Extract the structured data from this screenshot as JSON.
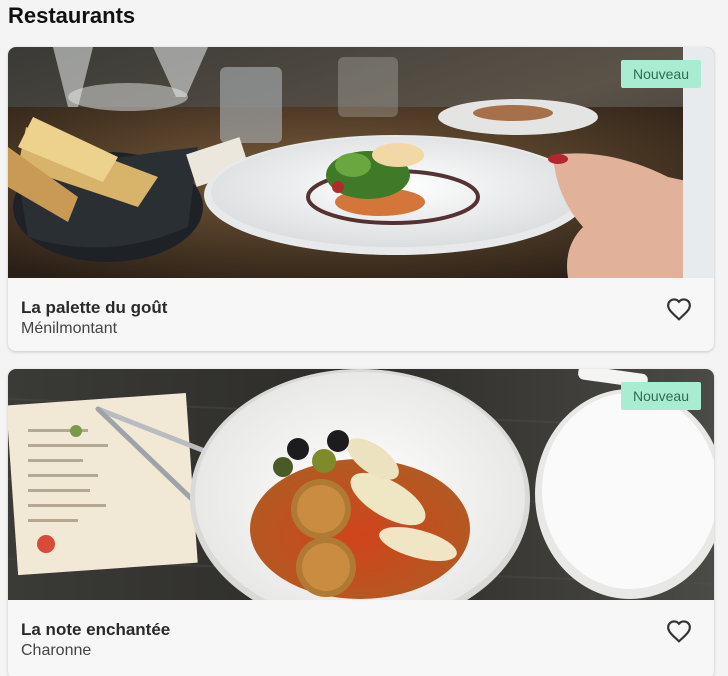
{
  "page": {
    "title": "Restaurants"
  },
  "restaurants": [
    {
      "name": "La palette du goût",
      "location": "Ménilmontant",
      "badge": "Nouveau",
      "favorite_icon": "heart-outline-icon",
      "image_description": "plated-dish-photo"
    },
    {
      "name": "La note enchantée",
      "location": "Charonne",
      "badge": "Nouveau",
      "favorite_icon": "heart-outline-icon",
      "image_description": "plated-dish-photo"
    }
  ],
  "colors": {
    "badge_background": "#a8ecd2",
    "badge_text": "#2f6b55",
    "page_background": "#f4f4f4",
    "card_background": "#f7f7f7"
  }
}
